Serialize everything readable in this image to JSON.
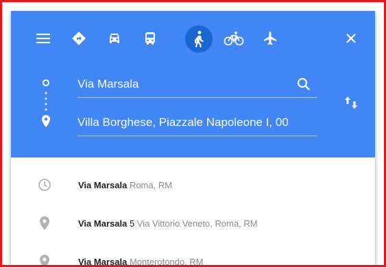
{
  "colors": {
    "header": "#4285f4",
    "active_mode": "#1a67d2",
    "frame_border": "#e8141c",
    "secondary_text": "#8a8a8a"
  },
  "toolbar": {
    "modes": [
      {
        "name": "menu-icon"
      },
      {
        "name": "best-route-icon"
      },
      {
        "name": "car-icon"
      },
      {
        "name": "transit-icon"
      },
      {
        "name": "walking-icon",
        "active": true
      },
      {
        "name": "bicycle-icon"
      },
      {
        "name": "flight-icon"
      }
    ],
    "close": "close-icon"
  },
  "directions": {
    "origin_value": "Via Marsala",
    "destination_value": "Villa Borghese, Piazzale Napoleone I, 00",
    "swap": "swap-icon",
    "search": "search-icon"
  },
  "suggestions": [
    {
      "icon": "history-icon",
      "main": "Via Marsala",
      "number": "",
      "secondary": "Roma, RM"
    },
    {
      "icon": "place-icon",
      "main": "Via Marsala",
      "number": "5",
      "secondary": "Via Vittorio Veneto, Roma, RM"
    },
    {
      "icon": "place-icon",
      "main": "Via Marsala",
      "number": "",
      "secondary": "Monterotondo, RM"
    }
  ]
}
